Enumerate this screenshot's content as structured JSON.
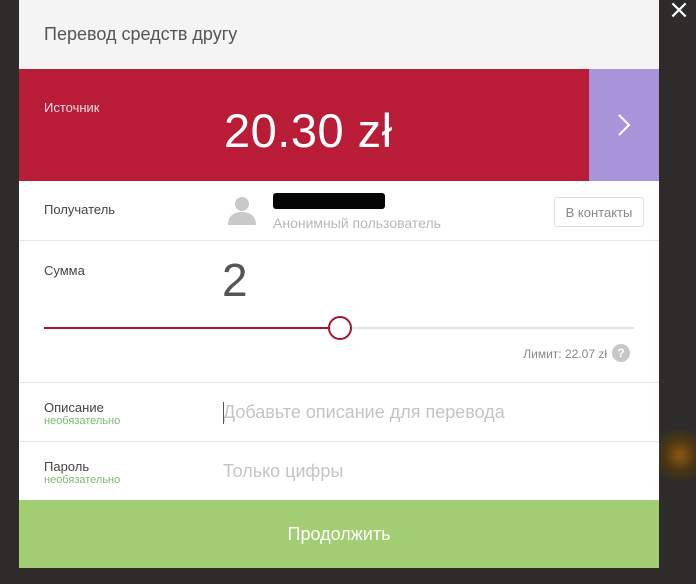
{
  "modal": {
    "title": "Перевод средств другу"
  },
  "source": {
    "label": "Источник",
    "amount": "20.30 zł",
    "next_icon": "chevron-right-icon"
  },
  "recipient": {
    "label": "Получатель",
    "hint": "Анонимный пользователь",
    "contacts_button": "В контакты",
    "avatar_icon": "user-silhouette-icon"
  },
  "amount": {
    "label": "Сумма",
    "value": "2",
    "slider_fraction": 0.5,
    "limit": "Лимит: 22.07 zł",
    "help_icon": "?"
  },
  "description": {
    "label": "Описание",
    "optional": "необязательно",
    "placeholder": "Добавьте описание для перевода"
  },
  "password": {
    "label": "Пароль",
    "optional": "необязательно",
    "placeholder": "Только цифры"
  },
  "continue_button": "Продолжить",
  "close_icon": "×",
  "colors": {
    "source_bg": "#b91c37",
    "next_bg": "#a993d9",
    "continue_bg": "#a3cd72",
    "slider": "#a3162f"
  }
}
